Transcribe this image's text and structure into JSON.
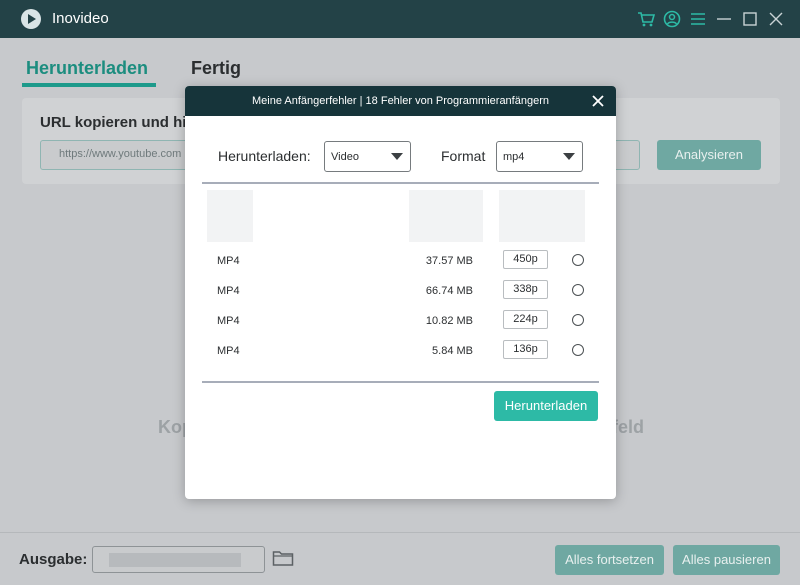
{
  "app": {
    "title": "Inovideo"
  },
  "titlebar_icons": [
    "cart-icon",
    "user-icon",
    "menu-icon",
    "minimize-icon",
    "maximize-icon",
    "close-icon"
  ],
  "tabs": [
    {
      "label": "Herunterladen",
      "active": true
    },
    {
      "label": "Fertig",
      "active": false
    }
  ],
  "url_panel": {
    "title": "URL kopieren und hie",
    "input_value": "https://www.youtube.com",
    "analyse_label": "Analysieren"
  },
  "drop_hint": {
    "left": "Kop",
    "right": "feld"
  },
  "bottom": {
    "output_label": "Ausgabe:",
    "resume_all_label": "Alles fortsetzen",
    "pause_all_label": "Alles pausieren"
  },
  "modal": {
    "title": "Meine Anfängerfehler | 18 Fehler von Programmieranfängern",
    "download_label": "Herunterladen:",
    "download_select_value": "Video",
    "format_label": "Format",
    "format_select_value": "mp4",
    "rows": [
      {
        "format": "MP4",
        "size": "37.57 MB",
        "resolution": "450p"
      },
      {
        "format": "MP4",
        "size": "66.74 MB",
        "resolution": "338p"
      },
      {
        "format": "MP4",
        "size": "10.82 MB",
        "resolution": "224p"
      },
      {
        "format": "MP4",
        "size": "5.84 MB",
        "resolution": "136p"
      }
    ],
    "submit_label": "Herunterladen"
  },
  "colors": {
    "titlebar": "#234247",
    "modal_header": "#16343a",
    "accent": "#1d9a8b",
    "primary_button": "#2dbaa6"
  }
}
